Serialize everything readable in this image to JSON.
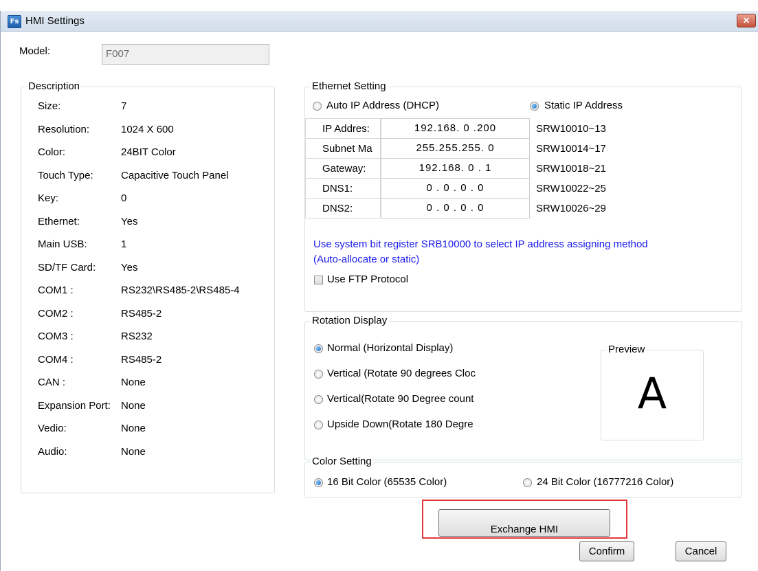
{
  "window": {
    "title": "HMI Settings",
    "app_icon_text": "Fs",
    "close_glyph": "×"
  },
  "model": {
    "label": "Model:",
    "value": "F007"
  },
  "description": {
    "legend": "Description",
    "rows": [
      {
        "label": "Size:",
        "value": "7"
      },
      {
        "label": "Resolution:",
        "value": "1024 X 600"
      },
      {
        "label": "Color:",
        "value": "24BIT Color"
      },
      {
        "label": "Touch Type:",
        "value": "Capacitive Touch Panel"
      },
      {
        "label": "Key:",
        "value": "0"
      },
      {
        "label": "Ethernet:",
        "value": "Yes"
      },
      {
        "label": "Main USB:",
        "value": "1"
      },
      {
        "label": "SD/TF Card:",
        "value": "Yes"
      },
      {
        "label": "COM1 :",
        "value": "RS232\\RS485-2\\RS485-4"
      },
      {
        "label": "COM2 :",
        "value": "RS485-2"
      },
      {
        "label": "COM3 :",
        "value": "RS232"
      },
      {
        "label": "COM4 :",
        "value": "RS485-2"
      },
      {
        "label": "CAN :",
        "value": "None"
      },
      {
        "label": "Expansion Port:",
        "value": "None"
      },
      {
        "label": "Vedio:",
        "value": "None"
      },
      {
        "label": "Audio:",
        "value": "None"
      }
    ]
  },
  "ethernet": {
    "legend": "Ethernet Setting",
    "auto_ip_label": "Auto IP Address (DHCP)",
    "static_ip_label": "Static IP Address",
    "static_ip_selected": true,
    "fields": [
      {
        "label": "IP Addres:",
        "value": "192.168. 0 .200",
        "register": "SRW10010~13"
      },
      {
        "label": "Subnet Ma",
        "value": "255.255.255. 0",
        "register": "SRW10014~17"
      },
      {
        "label": "Gateway:",
        "value": "192.168. 0 . 1",
        "register": "SRW10018~21"
      },
      {
        "label": "DNS1:",
        "value": "0 . 0 . 0 . 0",
        "register": "SRW10022~25"
      },
      {
        "label": "DNS2:",
        "value": "0 . 0 . 0 . 0",
        "register": "SRW10026~29"
      }
    ],
    "note_line1": "Use system bit register SRB10000 to select IP address assigning method",
    "note_line2": "(Auto-allocate or static)",
    "ftp_label": "Use FTP Protocol",
    "ftp_checked": false,
    "note_color": "#1a1aee"
  },
  "rotation": {
    "legend": "Rotation Display",
    "options": [
      {
        "label": "Normal (Horizontal Display)",
        "selected": true
      },
      {
        "label": "Vertical (Rotate 90 degrees Cloc",
        "selected": false
      },
      {
        "label": "Vertical(Rotate 90 Degree count",
        "selected": false
      },
      {
        "label": "Upside Down(Rotate 180 Degre",
        "selected": false
      }
    ],
    "preview_legend": "Preview",
    "preview_glyph": "A"
  },
  "color_setting": {
    "legend": "Color Setting",
    "option_16": "16 Bit Color (65535 Color)",
    "option_24": "24 Bit Color (16777216 Color)",
    "selected": "16"
  },
  "buttons": {
    "exchange": "Exchange HMI",
    "confirm": "Confirm",
    "cancel": "Cancel"
  },
  "colors": {
    "highlight": "#e23a3a",
    "window_bg": "#ffffff",
    "group_border": "#d5dfe5"
  }
}
